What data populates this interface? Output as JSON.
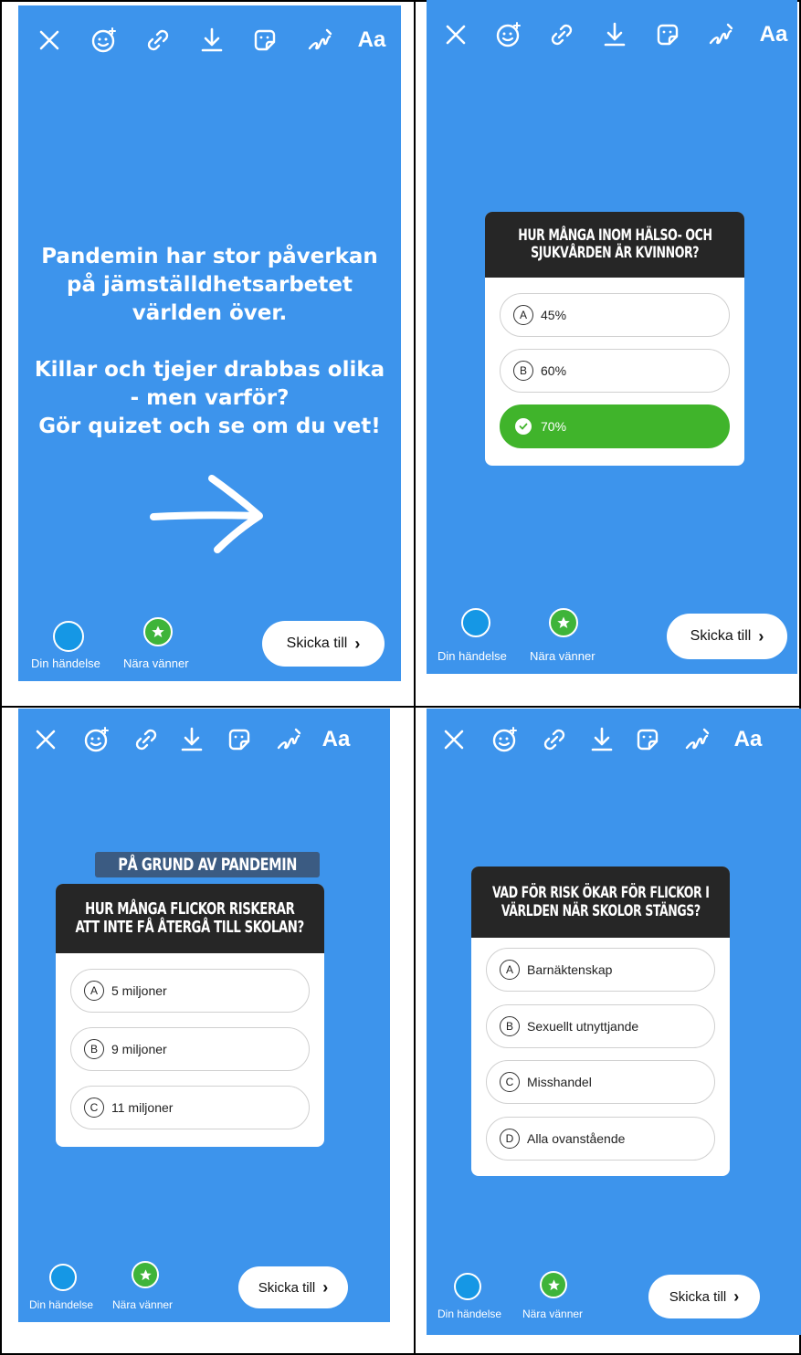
{
  "toolbar": {
    "icons": [
      "close-icon",
      "face-sparkle-icon",
      "link-icon",
      "download-icon",
      "sticker-icon",
      "draw-icon"
    ],
    "text_label": "Aa"
  },
  "screen1": {
    "lines": [
      "Pandemin har stor påverkan",
      "på jämställdhetsarbetet",
      "världen över.",
      "",
      "Killar och tjejer drabbas olika",
      "- men varför?",
      "Gör quizet och se om du vet!"
    ]
  },
  "screen2": {
    "question_lines": [
      "HUR MÅNGA INOM HÄLSO- OCH",
      "SJUKVÅRDEN ÄR KVINNOR?"
    ],
    "options": [
      {
        "letter": "A",
        "text": "45%"
      },
      {
        "letter": "B",
        "text": "60%"
      },
      {
        "letter": "C",
        "text": "70%",
        "correct": true
      }
    ]
  },
  "screen3": {
    "label": "PÅ GRUND AV PANDEMIN",
    "question_lines": [
      "HUR MÅNGA FLICKOR RISKERAR",
      "ATT INTE FÅ ÅTERGÅ TILL SKOLAN?"
    ],
    "options": [
      {
        "letter": "A",
        "text": "5 miljoner"
      },
      {
        "letter": "B",
        "text": "9 miljoner"
      },
      {
        "letter": "C",
        "text": "11 miljoner"
      }
    ]
  },
  "screen4": {
    "question_lines": [
      "VAD FÖR RISK ÖKAR FÖR FLICKOR I",
      "VÄRLDEN NÄR SKOLOR STÄNGS?"
    ],
    "options": [
      {
        "letter": "A",
        "text": "Barnäktenskap"
      },
      {
        "letter": "B",
        "text": "Sexuellt utnyttjande"
      },
      {
        "letter": "C",
        "text": "Misshandel"
      },
      {
        "letter": "D",
        "text": "Alla ovanstående"
      }
    ]
  },
  "share": {
    "your_story": "Din händelse",
    "close_friends": "Nära vänner",
    "send_to": "Skicka till"
  },
  "colors": {
    "background": "#3d94ec",
    "correct": "#40b42b",
    "question_bg": "#262626"
  }
}
